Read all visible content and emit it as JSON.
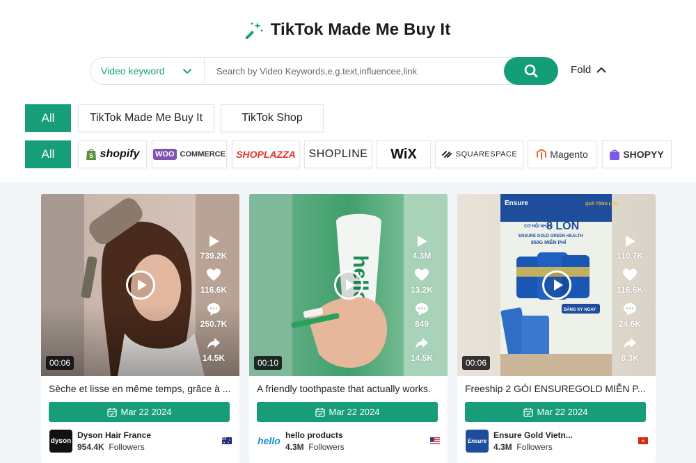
{
  "header": {
    "title": "TikTok Made Me Buy It"
  },
  "search": {
    "type_label": "Video keyword",
    "placeholder": "Search by Video Keywords,e.g.text,influencee,link",
    "fold_label": "Fold"
  },
  "category_filters": [
    "All",
    "TikTok Made Me Buy It",
    "TikTok Shop"
  ],
  "platform_filters": [
    "All",
    "shopify",
    "WOO COMMERCE",
    "SHOPLAZZA",
    "SHOPLINE",
    "WiX",
    "SQUARESPACE",
    "Magento",
    "SHOPYY"
  ],
  "colors": {
    "accent": "#169e7a"
  },
  "videos": [
    {
      "views": "739.2K",
      "likes": "116.6K",
      "comments": "250.7K",
      "shares": "14.5K",
      "duration": "00:06",
      "description": "Sèche et lisse en même temps, grâce à ...",
      "date": "Mar 22 2024",
      "author": "Dyson Hair France",
      "avatar_text": "dyson",
      "followers": "954.4K",
      "followers_label": "Followers",
      "flag": "australia-flag"
    },
    {
      "views": "4.3M",
      "likes": "13.2K",
      "comments": "849",
      "shares": "14.5K",
      "duration": "00:10",
      "description": "A friendly toothpaste that actually works.",
      "date": "Mar 22 2024",
      "author": "hello products",
      "avatar_text": "hello",
      "followers": "4.3M",
      "followers_label": "Followers",
      "flag": "usa-flag"
    },
    {
      "views": "110.7K",
      "likes": "116.6K",
      "comments": "24.6K",
      "shares": "8.3K",
      "duration": "00:06",
      "description": "Freeship 2 GÓI ENSUREGOLD MIỄN P...",
      "date": "Mar 22 2024",
      "author": "Ensure Gold Vietn...",
      "avatar_text": "Ensure",
      "followers": "4.3M",
      "followers_label": "Followers",
      "flag": "vietnam-flag"
    }
  ],
  "thumb_texts": {
    "tube_brand": "hello",
    "ad_title": "8 LON",
    "ad_line1": "CƠ HỘI NHẬN",
    "ad_line2": "ENSURE GOLD GREEN HEALTH",
    "ad_line3": "850G MIỄN PHÍ",
    "ad_cta": "ĐĂNG KÝ NGAY",
    "ad_badge": "QUÀ TẶNG LỚN",
    "ad_logo": "Ensure"
  }
}
